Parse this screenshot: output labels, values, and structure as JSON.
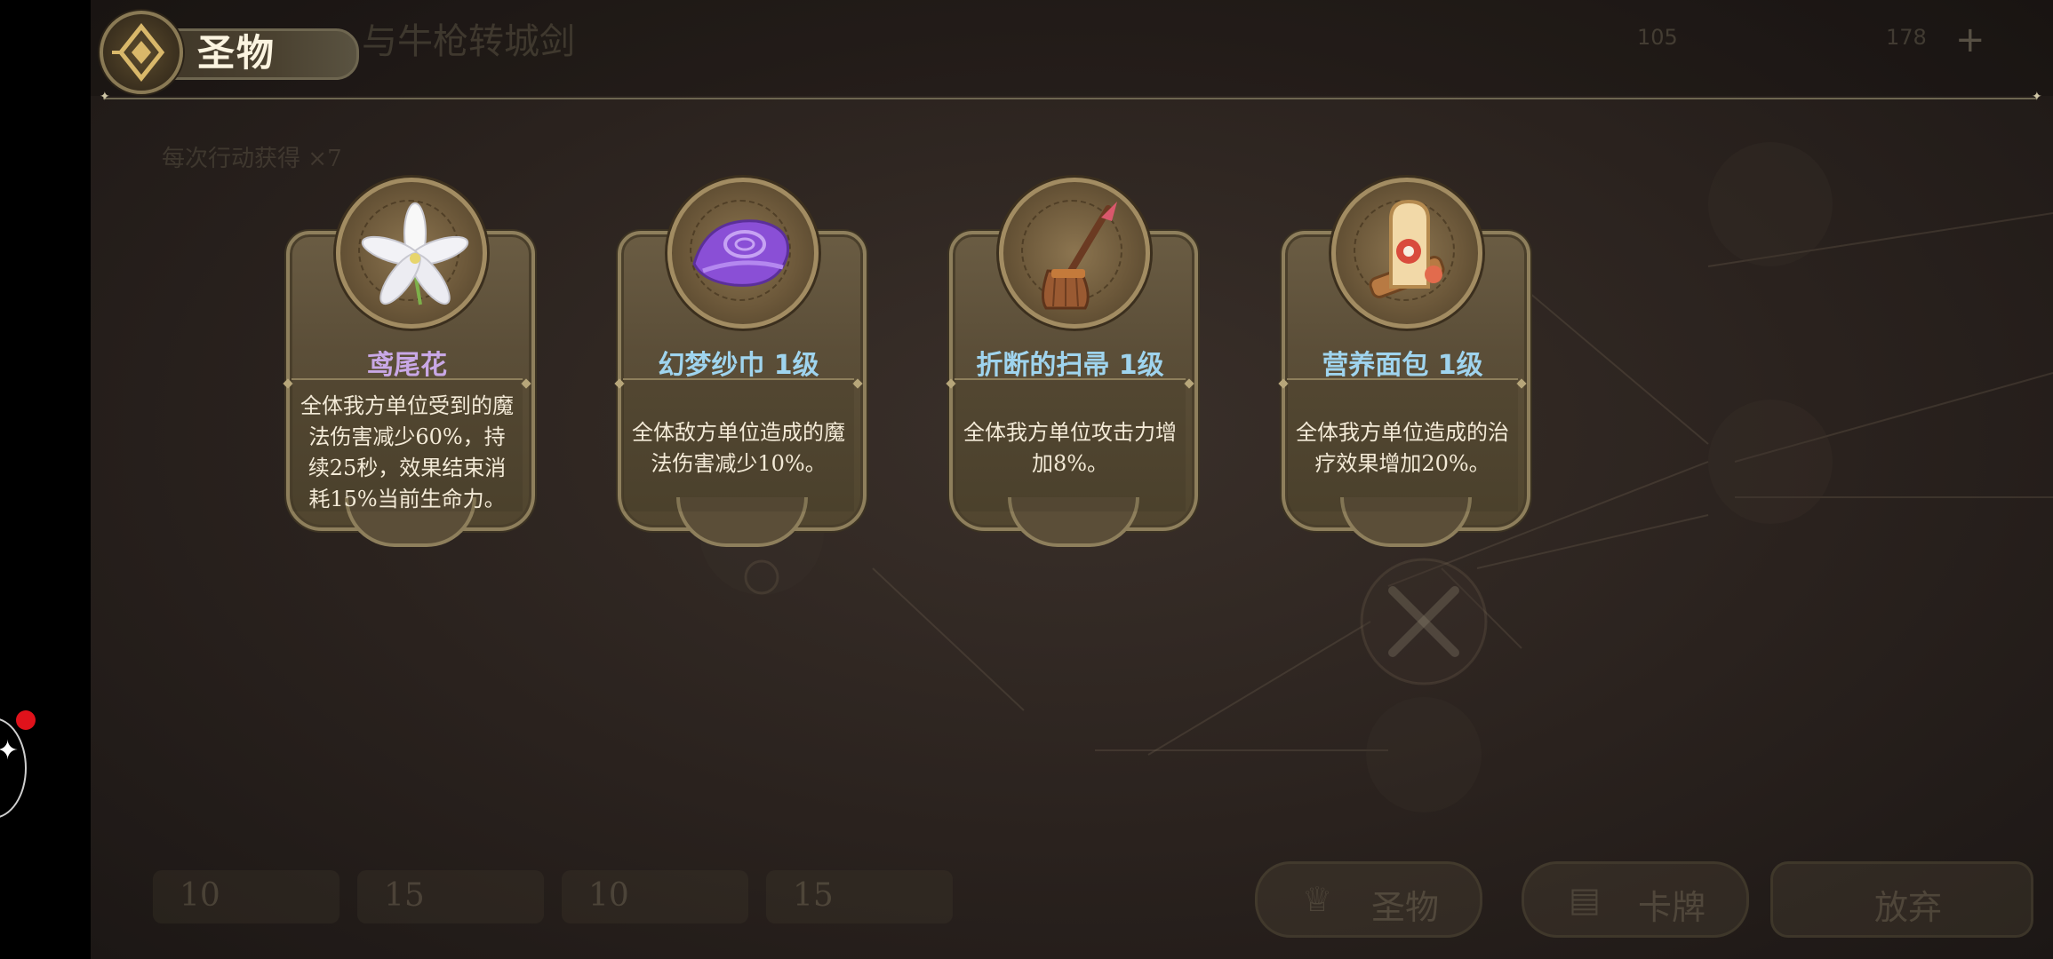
{
  "header": {
    "title": "圣物",
    "faded_title": "与牛枪转城剑"
  },
  "background": {
    "resource_1": "105",
    "resource_2": "178",
    "hint": "每次行动获得",
    "hint_count": "×7"
  },
  "relics": [
    {
      "name": "鸢尾花",
      "name_color": "#c9a8e6",
      "icon": "white-lily-icon",
      "description": "全体我方单位受到的魔法伤害减少60%，持续25秒，效果结束消耗15%当前生命力。"
    },
    {
      "name": "幻梦纱巾 1级",
      "name_color": "#9fd4ee",
      "icon": "purple-scarf-icon",
      "description": "全体敌方单位造成的魔法伤害减少10%。"
    },
    {
      "name": "折断的扫帚 1级",
      "name_color": "#9fd4ee",
      "icon": "broken-broom-icon",
      "description": "全体我方单位攻击力增加8%。"
    },
    {
      "name": "营养面包 1级",
      "name_color": "#9fd4ee",
      "icon": "bread-icon",
      "description": "全体我方单位造成的治疗效果增加20%。"
    }
  ],
  "bottom": {
    "costs": [
      "10",
      "15",
      "10",
      "15"
    ],
    "relic_button": "圣物",
    "card_button": "卡牌",
    "abandon_button": "放弃"
  }
}
